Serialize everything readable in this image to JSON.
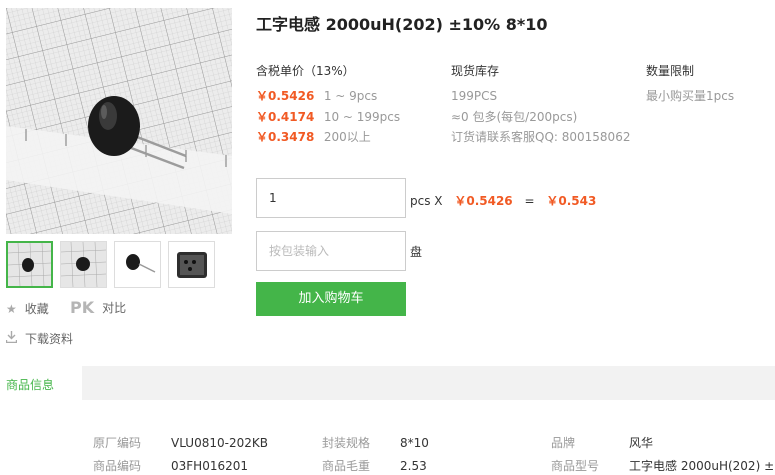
{
  "product": {
    "title": "工字电感 2000uH(202) ±10% 8*10"
  },
  "price_section": {
    "header": "含税单价（13%）",
    "tiers": [
      {
        "price": "￥0.5426",
        "range": "1 ~ 9pcs"
      },
      {
        "price": "￥0.4174",
        "range": "10 ~ 199pcs"
      },
      {
        "price": "￥0.3478",
        "range": "200以上"
      }
    ]
  },
  "stock_section": {
    "header": "现货库存",
    "rows": [
      "199PCS",
      "≈0 包多(每包/200pcs)",
      "订货请联系客服QQ: 800158062"
    ]
  },
  "limit_section": {
    "header": "数量限制",
    "rows": [
      "最小购买量1pcs"
    ]
  },
  "order": {
    "qty_value": "1",
    "unit_label": "pcs X",
    "unit_price": "￥0.5426",
    "equals": "=",
    "total": "￥0.543",
    "pack_placeholder": "按包装输入",
    "pack_unit": "盘",
    "add_cart_label": "加入购物车"
  },
  "side_actions": {
    "favorite": "收藏",
    "pk": "PK",
    "compare": "对比",
    "download": "下载资料"
  },
  "tabs": {
    "active": "商品信息"
  },
  "specs": [
    {
      "key": "原厂编码",
      "value": "VLU0810-202KB"
    },
    {
      "key": "封装规格",
      "value": "8*10"
    },
    {
      "key": "品牌",
      "value": "风华"
    },
    {
      "key": "商品编码",
      "value": "03FH016201"
    },
    {
      "key": "商品毛重",
      "value": "2.53"
    },
    {
      "key": "商品型号",
      "value": "工字电感 2000uH(202) ±1..."
    }
  ],
  "colors": {
    "accent_green": "#44b549",
    "price_orange": "#f15a24"
  }
}
